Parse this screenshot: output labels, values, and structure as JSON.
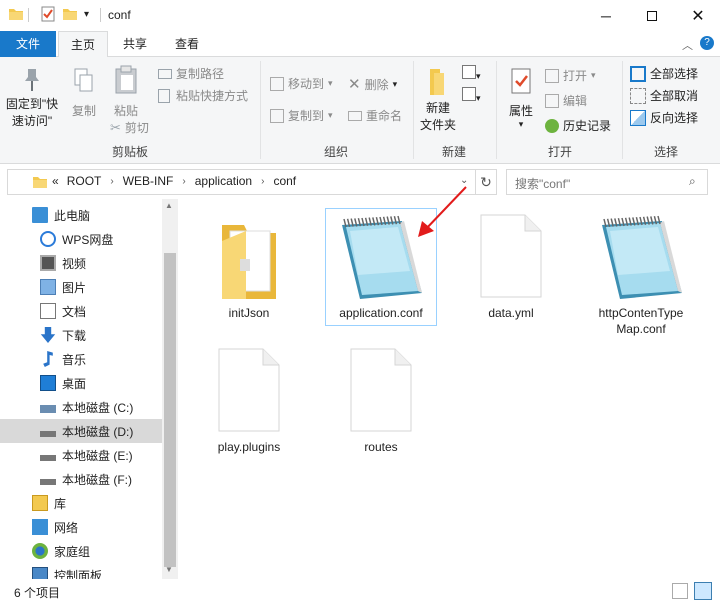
{
  "window": {
    "title": "conf",
    "minimize_icon": "minimize-icon",
    "maximize_icon": "maximize-icon",
    "close_icon": "close-icon"
  },
  "tabs": {
    "file": "文件",
    "home": "主页",
    "share": "共享",
    "view": "查看"
  },
  "ribbon": {
    "clipboard": {
      "pin": "固定到\"快\n速访问\"",
      "copy": "复制",
      "paste": "粘贴",
      "copy_path": "复制路径",
      "paste_shortcut": "粘贴快捷方式",
      "cut": "剪切",
      "label": "剪贴板"
    },
    "organize": {
      "move_to": "移动到",
      "copy_to": "复制到",
      "delete": "删除",
      "rename": "重命名",
      "label": "组织"
    },
    "new": {
      "new_folder": "新建\n文件夹",
      "label": "新建"
    },
    "open": {
      "properties": "属性",
      "open": "打开",
      "edit": "编辑",
      "history": "历史记录",
      "label": "打开"
    },
    "select": {
      "select_all": "全部选择",
      "select_none": "全部取消",
      "invert": "反向选择",
      "label": "选择"
    }
  },
  "address": {
    "overflow": "«",
    "crumbs": [
      "ROOT",
      "WEB-INF",
      "application",
      "conf"
    ],
    "search_placeholder": "搜索\"conf\""
  },
  "nav": [
    {
      "label": "此电脑",
      "icon": "computer-icon",
      "indent": 0
    },
    {
      "label": "WPS网盘",
      "icon": "cloud-icon",
      "indent": 1
    },
    {
      "label": "视频",
      "icon": "video-icon",
      "indent": 1
    },
    {
      "label": "图片",
      "icon": "pictures-icon",
      "indent": 1
    },
    {
      "label": "文档",
      "icon": "documents-icon",
      "indent": 1
    },
    {
      "label": "下载",
      "icon": "download-icon",
      "indent": 1
    },
    {
      "label": "音乐",
      "icon": "music-icon",
      "indent": 1
    },
    {
      "label": "桌面",
      "icon": "desktop-icon",
      "indent": 1
    },
    {
      "label": "本地磁盘 (C:)",
      "icon": "drive-c-icon",
      "indent": 1
    },
    {
      "label": "本地磁盘 (D:)",
      "icon": "drive-icon",
      "indent": 1,
      "selected": true
    },
    {
      "label": "本地磁盘 (E:)",
      "icon": "drive-icon",
      "indent": 1
    },
    {
      "label": "本地磁盘 (F:)",
      "icon": "drive-icon",
      "indent": 1
    },
    {
      "label": "库",
      "icon": "library-icon",
      "indent": 0
    },
    {
      "label": "网络",
      "icon": "network-icon",
      "indent": 0
    },
    {
      "label": "家庭组",
      "icon": "homegroup-icon",
      "indent": 0
    },
    {
      "label": "控制面板",
      "icon": "control-panel-icon",
      "indent": 0
    }
  ],
  "files": [
    {
      "name": "initJson",
      "type": "folder"
    },
    {
      "name": "application.conf",
      "type": "notepad",
      "selected": true
    },
    {
      "name": "data.yml",
      "type": "blank"
    },
    {
      "name": "httpContenType\nMap.conf",
      "type": "notepad"
    },
    {
      "name": "play.plugins",
      "type": "blank"
    },
    {
      "name": "routes",
      "type": "blank"
    }
  ],
  "annotation": {
    "arrow_color": "#e21b1b",
    "points_to": "application.conf"
  },
  "status": {
    "count": "6 个项目"
  },
  "colors": {
    "accent": "#1979ca",
    "selection_border": "#99d1ff",
    "selected_nav": "#d9d9d9"
  }
}
